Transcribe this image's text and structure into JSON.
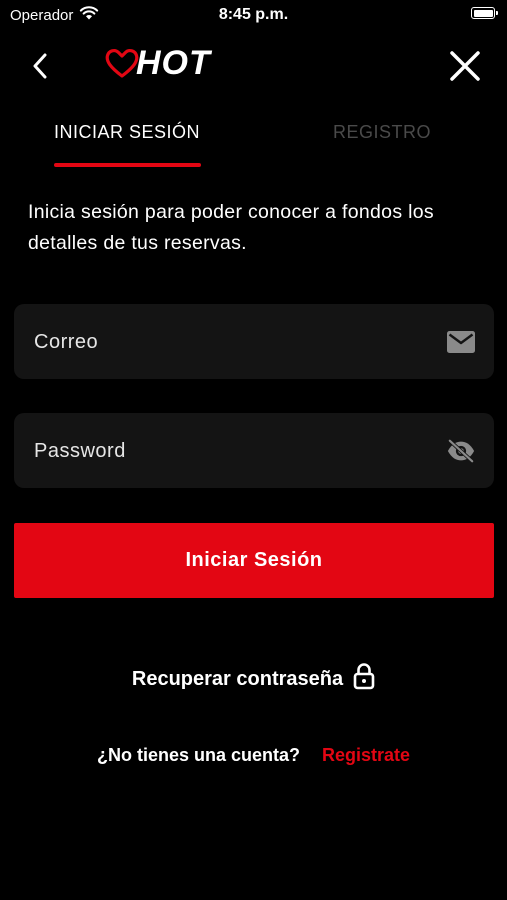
{
  "status_bar": {
    "carrier": "Operador",
    "time": "8:45 p.m."
  },
  "header": {
    "logo_text": "HOT",
    "icons": {
      "back": "chevron-left-icon",
      "close": "close-icon",
      "logo": "heart-logo-icon"
    }
  },
  "tabs": [
    {
      "label": "INICIAR SESIÓN",
      "active": true
    },
    {
      "label": "REGISTRO",
      "active": false
    }
  ],
  "intro_text": "Inicia sesión para poder conocer a fondos los detalles de tus reservas.",
  "form": {
    "email": {
      "placeholder": "Correo",
      "value": "",
      "icon": "mail-icon"
    },
    "password": {
      "placeholder": "Password",
      "value": "",
      "icon": "eye-off-icon"
    },
    "submit_label": "Iniciar Sesión"
  },
  "recover": {
    "label": "Recuperar contraseña",
    "icon": "lock-icon"
  },
  "register_prompt": {
    "question": "¿No tienes una cuenta?",
    "link": "Registrate"
  },
  "colors": {
    "accent": "#e30613",
    "background": "#000000",
    "field_background": "#141414",
    "inactive_tab": "#4a4a4a"
  }
}
